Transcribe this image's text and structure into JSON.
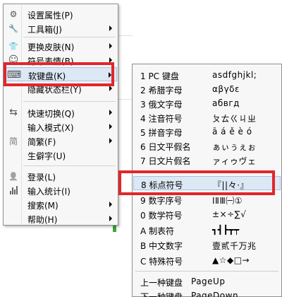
{
  "main_menu": {
    "items": [
      {
        "label": "设置属性(P)",
        "icon": "gear-icon",
        "glyph": "⚙",
        "arrow": false
      },
      {
        "label": "工具箱(J)",
        "icon": "wrench-icon",
        "glyph": "🔧",
        "arrow": true
      },
      {
        "label": "更换皮肤(N)",
        "icon": "shirt-icon",
        "glyph": "👕",
        "arrow": true
      },
      {
        "label": "符号表情(B)",
        "icon": "smiley-icon",
        "glyph": "☺",
        "arrow": true
      },
      {
        "label": "软键盘(K)",
        "icon": "keyboard-icon",
        "glyph": "⌨",
        "arrow": true
      },
      {
        "label": "隐藏状态栏(Y)",
        "icon": "",
        "glyph": "",
        "arrow": false
      },
      {
        "label": "快速切换(Q)",
        "icon": "switch-arrows-icon",
        "glyph": "⇆",
        "arrow": true
      },
      {
        "label": "输入模式(X)",
        "icon": "",
        "glyph": "",
        "arrow": true
      },
      {
        "label": "简繁(F)",
        "icon": "jian-char-icon",
        "glyph": "简",
        "arrow": true
      },
      {
        "label": "生僻字(U)",
        "icon": "",
        "glyph": "",
        "arrow": false
      },
      {
        "label": "登录(L)",
        "icon": "user-icon",
        "glyph": "👤",
        "arrow": false
      },
      {
        "label": "输入统计(I)",
        "icon": "bar-chart-icon",
        "glyph": "",
        "arrow": false
      },
      {
        "label": "搜索(M)",
        "icon": "",
        "glyph": "",
        "arrow": true
      },
      {
        "label": "帮助(H)",
        "icon": "",
        "glyph": "",
        "arrow": true
      }
    ]
  },
  "sub_menu": {
    "items": [
      {
        "label": "1 PC 键盘",
        "extra": "asdfghjkl;"
      },
      {
        "label": "2 希腊字母",
        "extra": "αβγδε"
      },
      {
        "label": "3 俄文字母",
        "extra": "абвгд"
      },
      {
        "label": "4 注音符号",
        "extra": "ㄆㄊㄍㄐㄓ"
      },
      {
        "label": "5 拼音字母",
        "extra": "ā á ě è ó"
      },
      {
        "label": "6 日文平假名",
        "extra": "ぁぃぅぇぉ"
      },
      {
        "label": "7 日文片假名",
        "extra": "ァィゥヴェ"
      },
      {
        "label": "8 标点符号",
        "extra": "『||々·』"
      },
      {
        "label": "9 数字序号",
        "extra": "ⅠⅡⅢ㈠①"
      },
      {
        "label": "0 数学符号",
        "extra": "±×÷∑√"
      },
      {
        "label": "A 制表符",
        "extra": "┓┫┣┳┯"
      },
      {
        "label": "B 中文数字",
        "extra": "壹贰千万兆"
      },
      {
        "label": "C 特殊符号",
        "extra": "▲☆◆□→"
      },
      {
        "label": "上一种键盘",
        "extra": "PageUp"
      },
      {
        "label": "下一种键盘",
        "extra": "PageDown"
      }
    ]
  },
  "colors": {
    "highlight_box": "#e0272b",
    "hover_bg": "#dde8f5"
  }
}
